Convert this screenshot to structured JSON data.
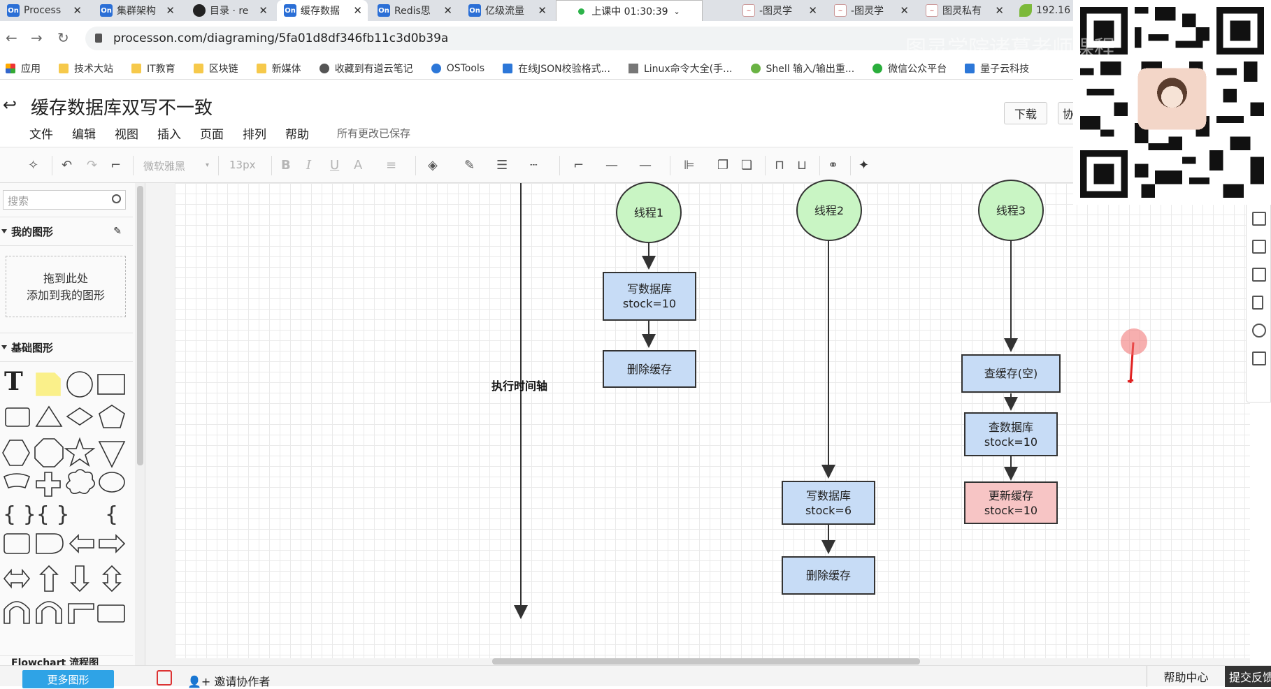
{
  "browser": {
    "tabs": [
      {
        "icon": "processon-icon",
        "label": "Process"
      },
      {
        "icon": "processon-icon",
        "label": "集群架构"
      },
      {
        "icon": "github-icon",
        "label": "目录 · re"
      },
      {
        "icon": "processon-icon",
        "label": "缓存数据"
      },
      {
        "icon": "processon-icon",
        "label": "Redis思"
      },
      {
        "icon": "processon-icon",
        "label": "亿级流量"
      },
      {
        "icon": "tuling-icon",
        "label": "-图灵学"
      },
      {
        "icon": "tuling-icon",
        "label": "-图灵学"
      },
      {
        "icon": "tuling-icon",
        "label": "图灵私有"
      },
      {
        "icon": "leaf-icon",
        "label": "192.16"
      }
    ],
    "fav_text": "On",
    "live_status": "上课中 01:30:39",
    "url": "processon.com/diagraming/5fa01d8df346fb11c3d0b39a",
    "watermark": "图灵学院诸葛老师课程",
    "bookmarks": [
      "应用",
      "技术大站",
      "IT教育",
      "区块链",
      "新媒体",
      "收藏到有道云笔记",
      "OSTools",
      "在线JSON校验格式...",
      "Linux命令大全(手...",
      "Shell 输入/输出重...",
      "微信公众平台",
      "量子云科技"
    ]
  },
  "app": {
    "doc_title": "缓存数据库双写不一致",
    "menus": [
      "文件",
      "编辑",
      "视图",
      "插入",
      "页面",
      "排列",
      "帮助"
    ],
    "save_status": "所有更改已保存",
    "download_label": "下载",
    "share_label": "协",
    "font_family": "微软雅黑",
    "font_size": "13px"
  },
  "left_panel": {
    "search_placeholder": "搜索",
    "my_shapes_title": "我的图形",
    "dropzone_line1": "拖到此处",
    "dropzone_line2": "添加到我的图形",
    "basic_shapes_title": "基础图形",
    "flowchart_title": "Flowchart 流程图",
    "more_shapes": "更多图形"
  },
  "diagram": {
    "timeline_label": "执行时间轴",
    "threads": [
      {
        "label": "线程1",
        "steps": [
          {
            "lines": [
              "写数据库",
              "stock=10"
            ],
            "color": "blue"
          },
          {
            "lines": [
              "删除缓存"
            ],
            "color": "blue"
          }
        ]
      },
      {
        "label": "线程2",
        "steps": [
          {
            "lines": [
              "写数据库",
              "stock=6"
            ],
            "color": "blue"
          },
          {
            "lines": [
              "删除缓存"
            ],
            "color": "blue"
          }
        ]
      },
      {
        "label": "线程3",
        "steps": [
          {
            "lines": [
              "查缓存(空)"
            ],
            "color": "blue"
          },
          {
            "lines": [
              "查数据库",
              "stock=10"
            ],
            "color": "blue"
          },
          {
            "lines": [
              "更新缓存",
              "stock=10"
            ],
            "color": "pink"
          }
        ]
      }
    ],
    "colors": {
      "circle": "#c9f5c4",
      "box": "#c7dcf6",
      "pink": "#f7c5c5"
    }
  },
  "footer": {
    "invite": "邀请协作者",
    "help_center": "帮助中心",
    "feedback": "提交反馈"
  }
}
